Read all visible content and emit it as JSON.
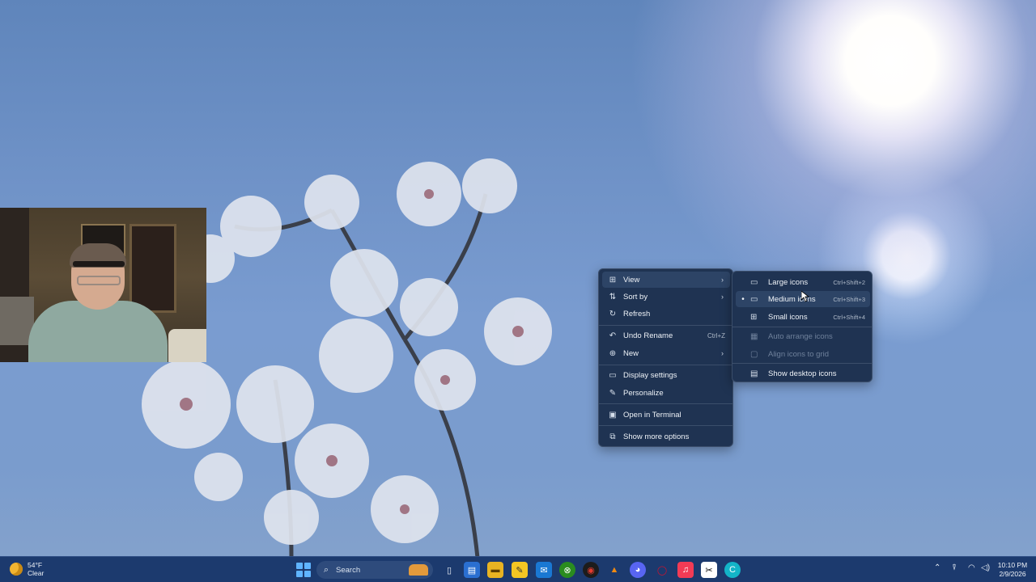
{
  "context_menu": {
    "items": [
      {
        "label": "View",
        "icon": "grid-icon",
        "has_submenu": true
      },
      {
        "label": "Sort by",
        "icon": "sort-icon",
        "has_submenu": true
      },
      {
        "label": "Refresh",
        "icon": "refresh-icon"
      },
      {
        "label": "Undo Rename",
        "icon": "undo-icon",
        "shortcut": "Ctrl+Z"
      },
      {
        "label": "New",
        "icon": "plus-circle-icon",
        "has_submenu": true
      },
      {
        "label": "Display settings",
        "icon": "monitor-icon"
      },
      {
        "label": "Personalize",
        "icon": "pen-icon"
      },
      {
        "label": "Open in Terminal",
        "icon": "terminal-icon"
      },
      {
        "label": "Show more options",
        "icon": "share-icon"
      }
    ]
  },
  "view_submenu": {
    "items": [
      {
        "label": "Large icons",
        "shortcut": "Ctrl+Shift+2"
      },
      {
        "label": "Medium icons",
        "shortcut": "Ctrl+Shift+3",
        "selected": true
      },
      {
        "label": "Small icons",
        "shortcut": "Ctrl+Shift+4"
      },
      {
        "label": "Auto arrange icons",
        "disabled": true
      },
      {
        "label": "Align icons to grid",
        "disabled": true
      },
      {
        "label": "Show desktop icons"
      }
    ]
  },
  "taskbar": {
    "weather": {
      "temp": "54°F",
      "condition": "Clear"
    },
    "search_label": "Search",
    "clock": {
      "time": "10:10 PM",
      "date": "2/9/2026"
    },
    "pinned_apps": [
      "task-view",
      "microsoft-store",
      "file-explorer",
      "sticky-notes",
      "outlook",
      "xbox",
      "chrome",
      "vlc",
      "discord",
      "opera",
      "apple-music",
      "capcut",
      "cursor-app"
    ],
    "accent": "#1c3a6e"
  }
}
